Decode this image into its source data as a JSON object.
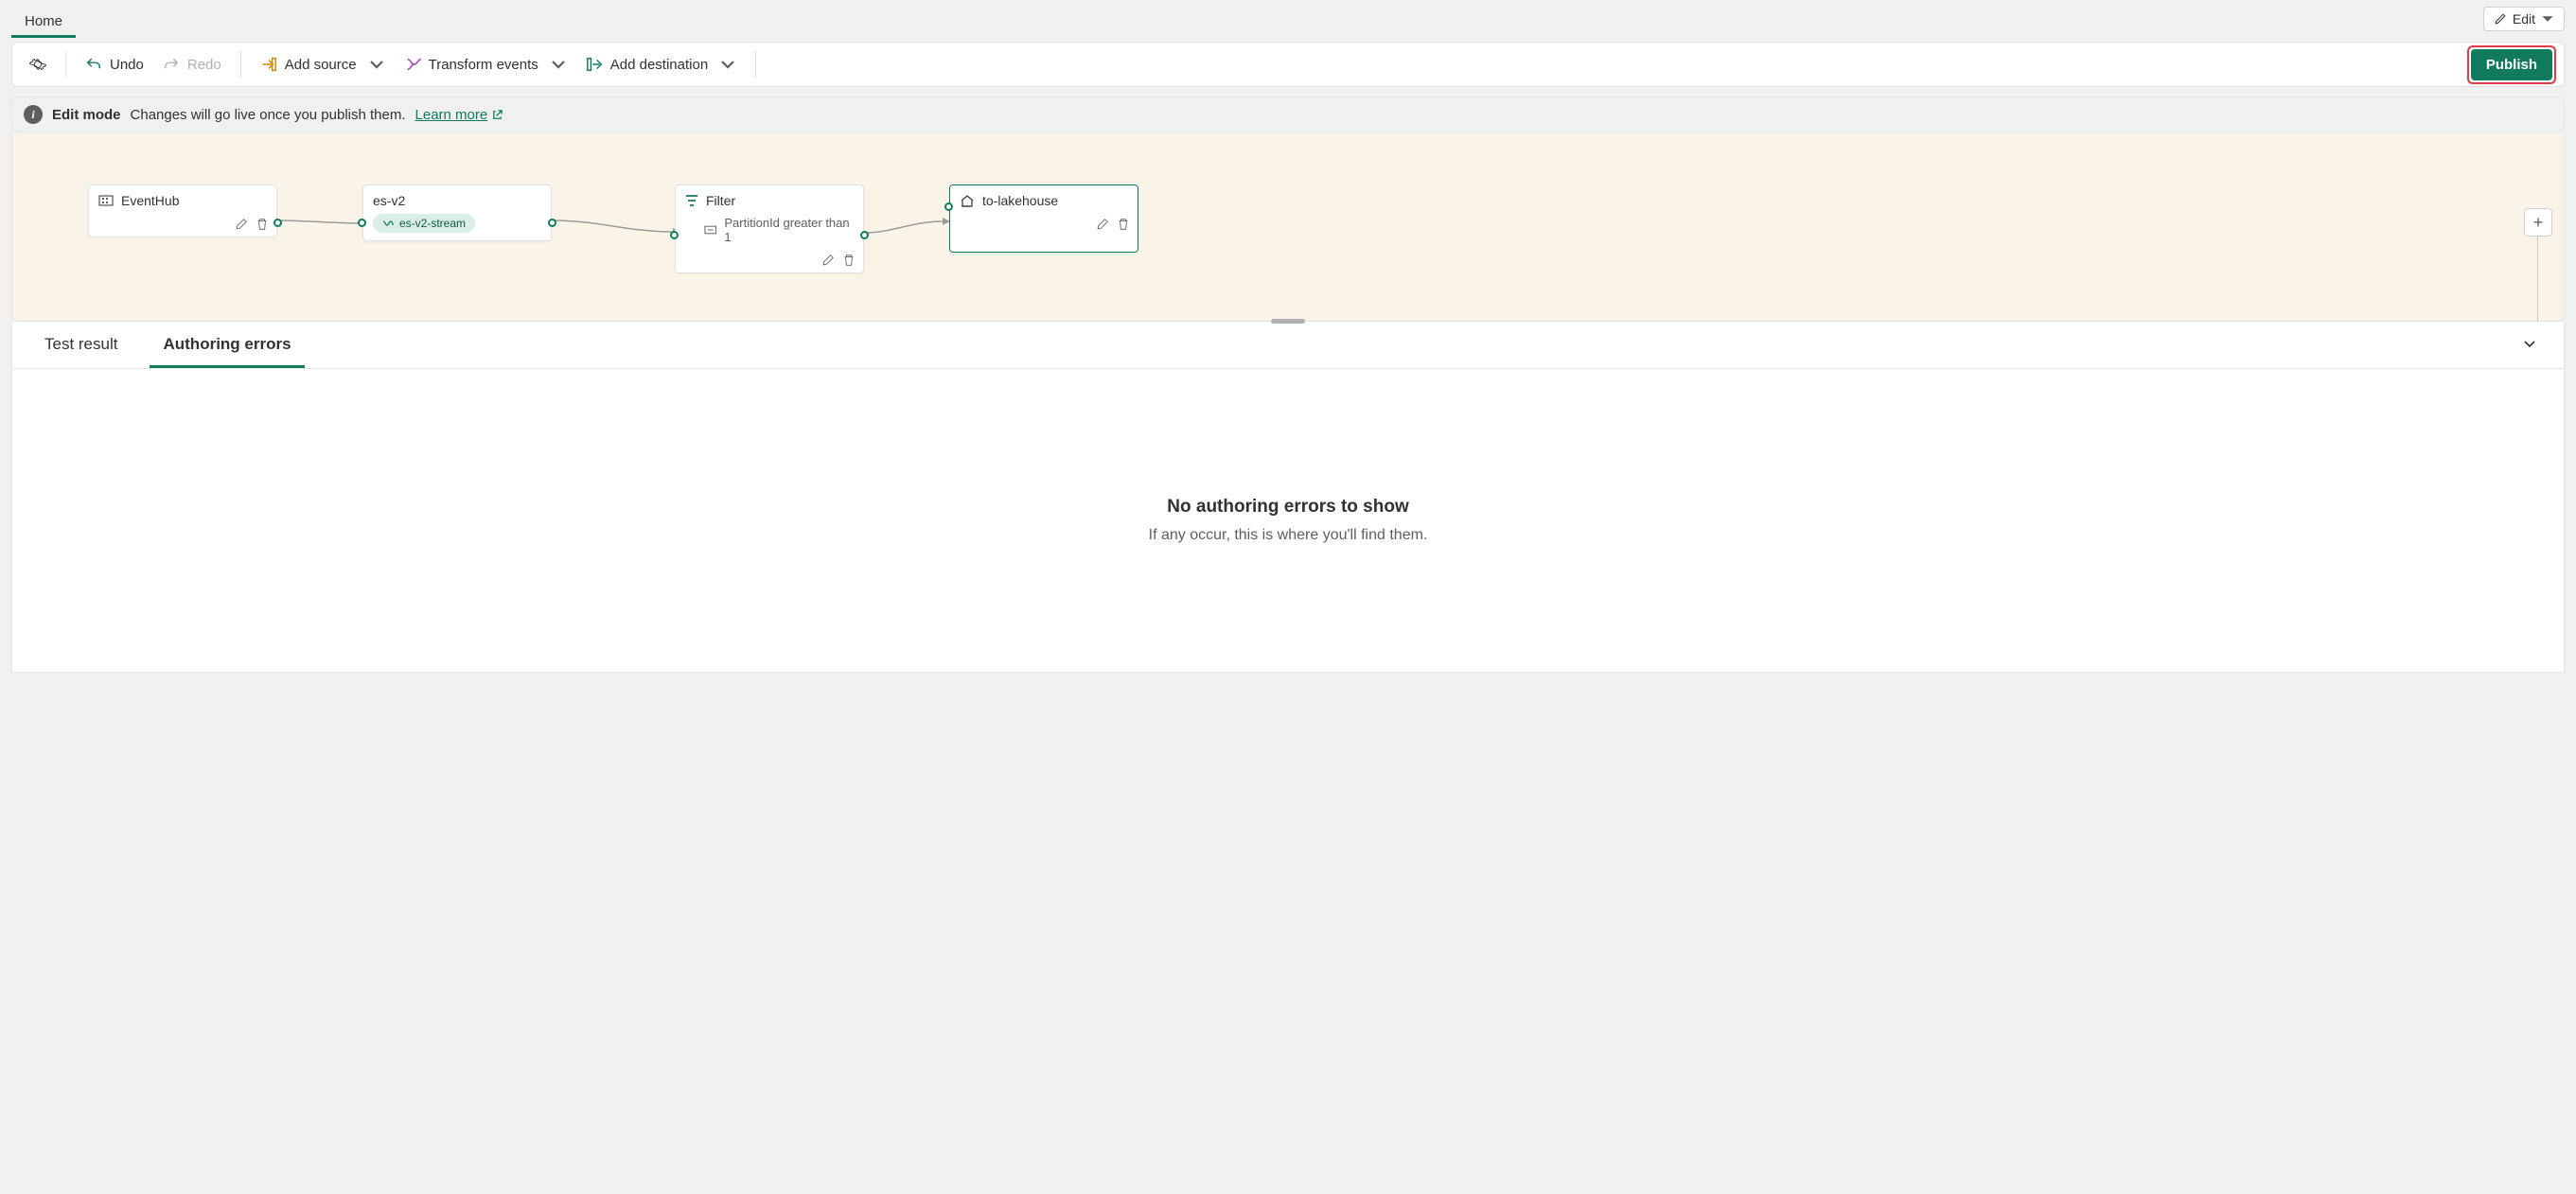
{
  "topTabs": {
    "home": "Home"
  },
  "editButton": "Edit",
  "toolbar": {
    "undo": "Undo",
    "redo": "Redo",
    "addSource": "Add source",
    "transformEvents": "Transform events",
    "addDestination": "Add destination",
    "publish": "Publish"
  },
  "infoBar": {
    "mode": "Edit mode",
    "message": "Changes will go live once you publish them.",
    "learnMore": "Learn more"
  },
  "nodes": {
    "source": {
      "label": "EventHub"
    },
    "stream": {
      "label": "es-v2",
      "streamChip": "es-v2-stream"
    },
    "filter": {
      "label": "Filter",
      "condition": "PartitionId greater than 1"
    },
    "dest": {
      "label": "to-lakehouse"
    }
  },
  "bottomTabs": {
    "testResult": "Test result",
    "authoringErrors": "Authoring errors"
  },
  "emptyState": {
    "title": "No authoring errors to show",
    "sub": "If any occur, this is where you'll find them."
  }
}
